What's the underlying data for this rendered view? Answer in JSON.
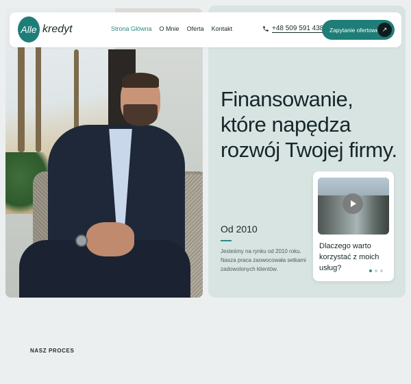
{
  "header": {
    "logo_mark": "Alle",
    "logo_text": "kredyt",
    "nav": [
      {
        "label": "Strona Główna",
        "active": true
      },
      {
        "label": "O Mnie"
      },
      {
        "label": "Oferta"
      },
      {
        "label": "Kontakt"
      }
    ],
    "phone": "+48 509 591 438",
    "cta_label": "Zapytanie ofertowe",
    "cta_icon": "arrow-up-right-icon",
    "phone_icon": "phone-icon"
  },
  "hero": {
    "title": "Finansowanie, które napędza rozwój Twojej firmy.",
    "since_label": "Od 2010",
    "since_text": "Jesteśmy na rynku od 2010 roku. Nasza praca zaowocowała setkami zadowolonych klientów.",
    "video_card": {
      "text": "Dlaczego warto korzystać z moich usług?",
      "play_icon": "play-icon",
      "slides": 3,
      "active_slide": 1
    }
  },
  "process": {
    "label": "NASZ PROCES"
  },
  "colors": {
    "accent": "#1f7d78",
    "hero_bg": "#d8e4e2",
    "page_bg": "#eceff0"
  }
}
